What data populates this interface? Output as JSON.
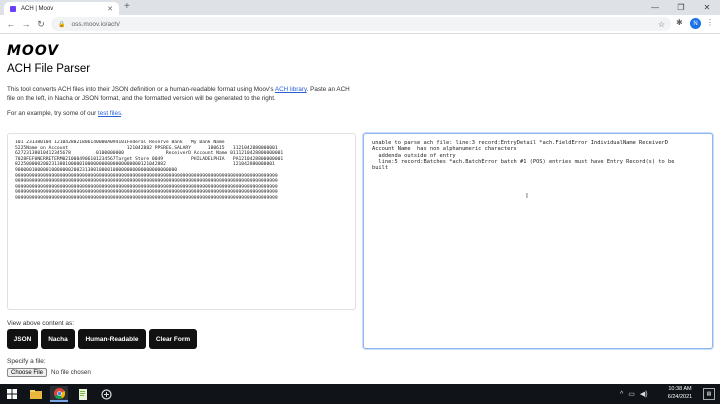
{
  "browser": {
    "tab_title": "ACH | Moov",
    "tab_close": "✕",
    "new_tab": "+",
    "minimize": "—",
    "maximize": "❐",
    "close": "✕",
    "back": "←",
    "forward": "→",
    "reload": "↻",
    "url": "oss.moov.io/ach/",
    "profile_initial": "N",
    "menu": "⋮"
  },
  "page": {
    "logo": "MOOV",
    "title": "ACH File Parser",
    "intro": {
      "p1": "This tool converts ACH files into their JSON definition or a human-readable format using Moov's ",
      "link1": "ACH library",
      "p2": ". Paste an ACH file on the left, in Nacha or JSON format, and the formatted version will be generated to the right."
    },
    "example": {
      "prefix": "For an example, try some of our ",
      "link": "test files",
      "suffix": "."
    },
    "ach_input": "101 231380104 1210428821806140000A094101Federal Reserve Bank   My Bank Name\n5225Name on Account                     121042882 PPSREG.SALARY      180615   1121042880000001\n62723138010412345678         0100000000               ReceiverD Account Name 0111210428800000001\n7028FEF0NERRETERM0210004906101234567Target Store 0049          PHILADELPHIA   PA1210428800000001\n822500000200231380100000100000000000000000000121042882                        121042880000001\n9000001000001000000020023138010000100000000000000000000000\n9999999999999999999999999999999999999999999999999999999999999999999999999999999999999999999999\n9999999999999999999999999999999999999999999999999999999999999999999999999999999999999999999999\n9999999999999999999999999999999999999999999999999999999999999999999999999999999999999999999999\n9999999999999999999999999999999999999999999999999999999999999999999999999999999999999999999999\n9999999999999999999999999999999999999999999999999999999999999999999999999999999999999999999999",
    "output": "unable to parse ach file: line:3 record:EntryDetail *ach.FieldError IndividualName ReceiverD\nAccount Name  has non alphanumeric characters\n  addenda outside of entry\n  line:5 record:Batches *ach.BatchError batch #1 (POS) entries must have Entry Record(s) to be\nbuilt",
    "view_label": "View above content as:",
    "buttons": {
      "json": "JSON",
      "nacha": "Nacha",
      "human": "Human-Readable",
      "clear": "Clear Form"
    },
    "specify_label": "Specify a file:",
    "choose_file": "Choose File",
    "no_file": "No file chosen"
  },
  "taskbar": {
    "time": "10:38 AM",
    "date": "6/24/2021"
  }
}
